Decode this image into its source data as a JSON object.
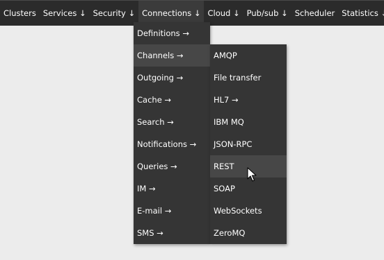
{
  "menubar": {
    "items": [
      {
        "label": "Clusters"
      },
      {
        "label": "Services ↓"
      },
      {
        "label": "Security ↓"
      },
      {
        "label": "Connections ↓"
      },
      {
        "label": "Cloud ↓"
      },
      {
        "label": "Pub/sub ↓"
      },
      {
        "label": "Scheduler"
      },
      {
        "label": "Statistics ↓"
      }
    ]
  },
  "connections_menu": {
    "items": [
      {
        "label": "Definitions →"
      },
      {
        "label": "Channels →"
      },
      {
        "label": "Outgoing →"
      },
      {
        "label": "Cache →"
      },
      {
        "label": "Search →"
      },
      {
        "label": "Notifications →"
      },
      {
        "label": "Queries →"
      },
      {
        "label": "IM →"
      },
      {
        "label": "E-mail →"
      },
      {
        "label": "SMS →"
      }
    ]
  },
  "channels_submenu": {
    "items": [
      {
        "label": "AMQP"
      },
      {
        "label": "File transfer"
      },
      {
        "label": "HL7 →"
      },
      {
        "label": "IBM MQ"
      },
      {
        "label": "JSON-RPC"
      },
      {
        "label": "REST"
      },
      {
        "label": "SOAP"
      },
      {
        "label": "WebSockets"
      },
      {
        "label": "ZeroMQ"
      }
    ]
  },
  "colors": {
    "menubar_bg": "#2b2b2b",
    "dropdown_bg": "#353535",
    "highlight_bg": "#474747",
    "page_bg": "#ececec",
    "text": "#ffffff"
  }
}
